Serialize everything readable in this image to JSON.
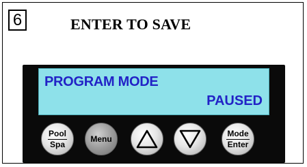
{
  "step": {
    "number": "6"
  },
  "instruction": {
    "title": "ENTER TO SAVE"
  },
  "display": {
    "line1": "PROGRAM MODE",
    "line2": "PAUSED",
    "background_color": "#8ee1ea",
    "text_color": "#2222c6"
  },
  "buttons": {
    "pool_spa": {
      "top": "Pool",
      "bottom": "Spa"
    },
    "menu": {
      "label": "Menu"
    },
    "up": {
      "icon": "triangle-up-icon"
    },
    "down": {
      "icon": "triangle-down-icon"
    },
    "mode_enter": {
      "top": "Mode",
      "bottom": "Enter"
    }
  }
}
